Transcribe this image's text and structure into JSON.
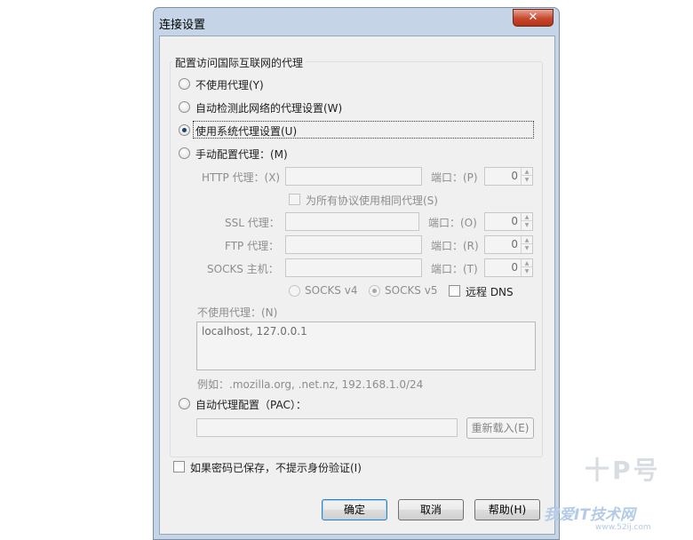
{
  "window": {
    "title": "连接设置",
    "close_glyph": "✕"
  },
  "group": {
    "title": "配置访问国际互联网的代理"
  },
  "options": {
    "no_proxy": "不使用代理(Y)",
    "auto_detect": "自动检测此网络的代理设置(W)",
    "system_proxy": "使用系统代理设置(U)",
    "manual": "手动配置代理：(M)",
    "auto_pac": "自动代理配置（PAC）："
  },
  "selected_option": "system_proxy",
  "manual_proxy": {
    "port_label": "端口：",
    "http": {
      "label": "HTTP 代理：(X)",
      "host": "",
      "port_label": "端口：(P)",
      "port": "0"
    },
    "same_for_all": "为所有协议使用相同代理(S)",
    "ssl": {
      "label": "SSL 代理：",
      "host": "",
      "port_label": "端口：(O)",
      "port": "0"
    },
    "ftp": {
      "label": "FTP 代理：",
      "host": "",
      "port_label": "端口：(R)",
      "port": "0"
    },
    "socks": {
      "label": "SOCKS 主机：",
      "host": "",
      "port_label": "端口：(T)",
      "port": "0"
    },
    "socks_v4": "SOCKS v4",
    "socks_v5": "SOCKS v5",
    "remote_dns": "远程 DNS",
    "no_proxy_for_label": "不使用代理：(N)",
    "no_proxy_for_value": "localhost, 127.0.0.1",
    "example": "例如：.mozilla.org, .net.nz, 192.168.1.0/24"
  },
  "pac": {
    "url": "",
    "reload_button": "重新载入(E)"
  },
  "no_auth_prompt": "如果密码已保存，不提示身份验证(I)",
  "buttons": {
    "ok": "确定",
    "cancel": "取消",
    "help": "帮助(H)"
  },
  "watermark": {
    "line1": "十P号",
    "line2": "我爱IT技术网",
    "line3": "www.52ij.com"
  },
  "colors": {
    "title_bar": "#c5d4e6",
    "close_button": "#c7472e",
    "dialog_bg": "#f0f0f0",
    "radio_dot": "#1a3f73"
  }
}
